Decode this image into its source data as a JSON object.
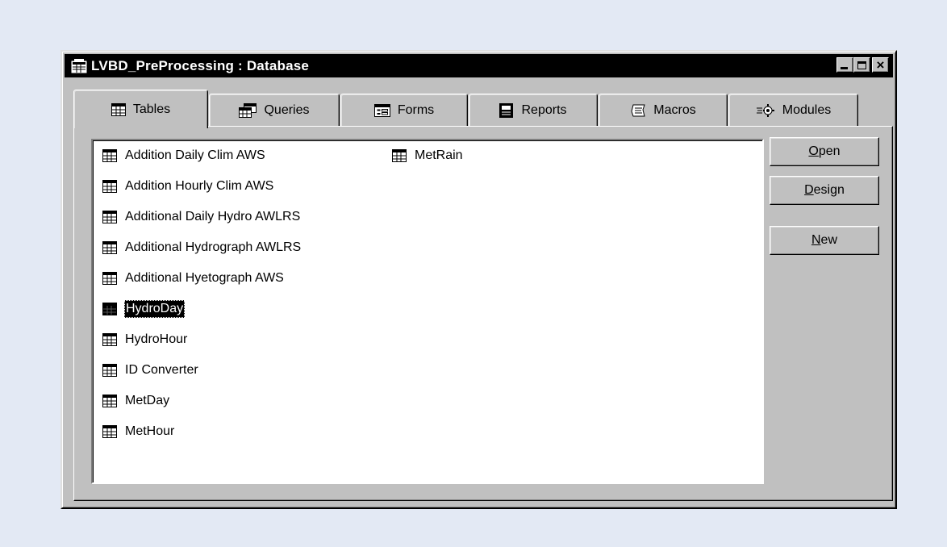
{
  "window": {
    "title": "LVBD_PreProcessing : Database",
    "controls": {
      "minimize": "minimize",
      "maximize": "maximize",
      "close": "×"
    }
  },
  "tabs": [
    {
      "label": "Tables",
      "icon": "table-icon",
      "active": true
    },
    {
      "label": "Queries",
      "icon": "query-icon",
      "active": false
    },
    {
      "label": "Forms",
      "icon": "form-icon",
      "active": false
    },
    {
      "label": "Reports",
      "icon": "report-icon",
      "active": false
    },
    {
      "label": "Macros",
      "icon": "macro-icon",
      "active": false
    },
    {
      "label": "Modules",
      "icon": "module-icon",
      "active": false
    }
  ],
  "tables": [
    {
      "name": "Addition Daily Clim  AWS",
      "selected": false
    },
    {
      "name": "Addition Hourly Clim AWS",
      "selected": false
    },
    {
      "name": "Additional Daily Hydro AWLRS",
      "selected": false
    },
    {
      "name": "Additional Hydrograph AWLRS",
      "selected": false
    },
    {
      "name": "Additional Hyetograph AWS",
      "selected": false
    },
    {
      "name": "HydroDay",
      "selected": true
    },
    {
      "name": "HydroHour",
      "selected": false
    },
    {
      "name": "ID Converter",
      "selected": false
    },
    {
      "name": "MetDay",
      "selected": false
    },
    {
      "name": "MetHour",
      "selected": false
    },
    {
      "name": "MetRain",
      "selected": false
    }
  ],
  "buttons": {
    "open": {
      "accel": "O",
      "rest": "pen"
    },
    "design": {
      "accel": "D",
      "rest": "esign"
    },
    "new": {
      "accel": "N",
      "rest": "ew"
    }
  },
  "colors": {
    "background": "#e3e9f4",
    "window": "#c0c0c0",
    "titlebar": "#000000",
    "selection": "#000000"
  }
}
